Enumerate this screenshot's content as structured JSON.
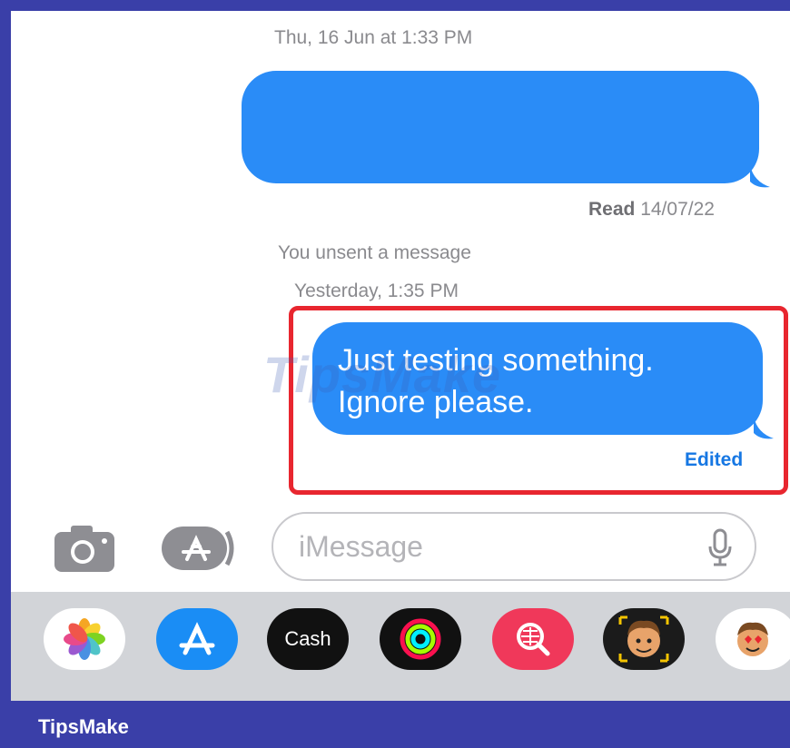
{
  "conversation": {
    "timestamp_1": "Thu, 16 Jun at 1:33 PM",
    "read_label": "Read",
    "read_date": "14/07/22",
    "unsent_notice": "You unsent a message",
    "timestamp_2": "Yesterday, 1:35 PM",
    "message_line_1": "Just testing something.",
    "message_line_2": "Ignore please.",
    "edited_label": "Edited"
  },
  "watermark": "TipsMake",
  "input": {
    "placeholder": "iMessage"
  },
  "app_tray": {
    "apps": [
      {
        "name": "Photos",
        "icon": "photos-icon"
      },
      {
        "name": "App Store",
        "icon": "app-store-icon"
      },
      {
        "name": "Apple Cash",
        "icon": "apple-cash-icon",
        "label": "Cash"
      },
      {
        "name": "Activity",
        "icon": "activity-rings-icon"
      },
      {
        "name": "Search Images",
        "icon": "image-search-icon"
      },
      {
        "name": "Memoji",
        "icon": "memoji-icon"
      },
      {
        "name": "Memoji Stickers",
        "icon": "memoji-stickers-icon"
      }
    ]
  },
  "footer": {
    "brand": "TipsMake"
  },
  "colors": {
    "bubble": "#2a8cf7",
    "highlight": "#e8262f",
    "frame": "#3a3fa8"
  }
}
